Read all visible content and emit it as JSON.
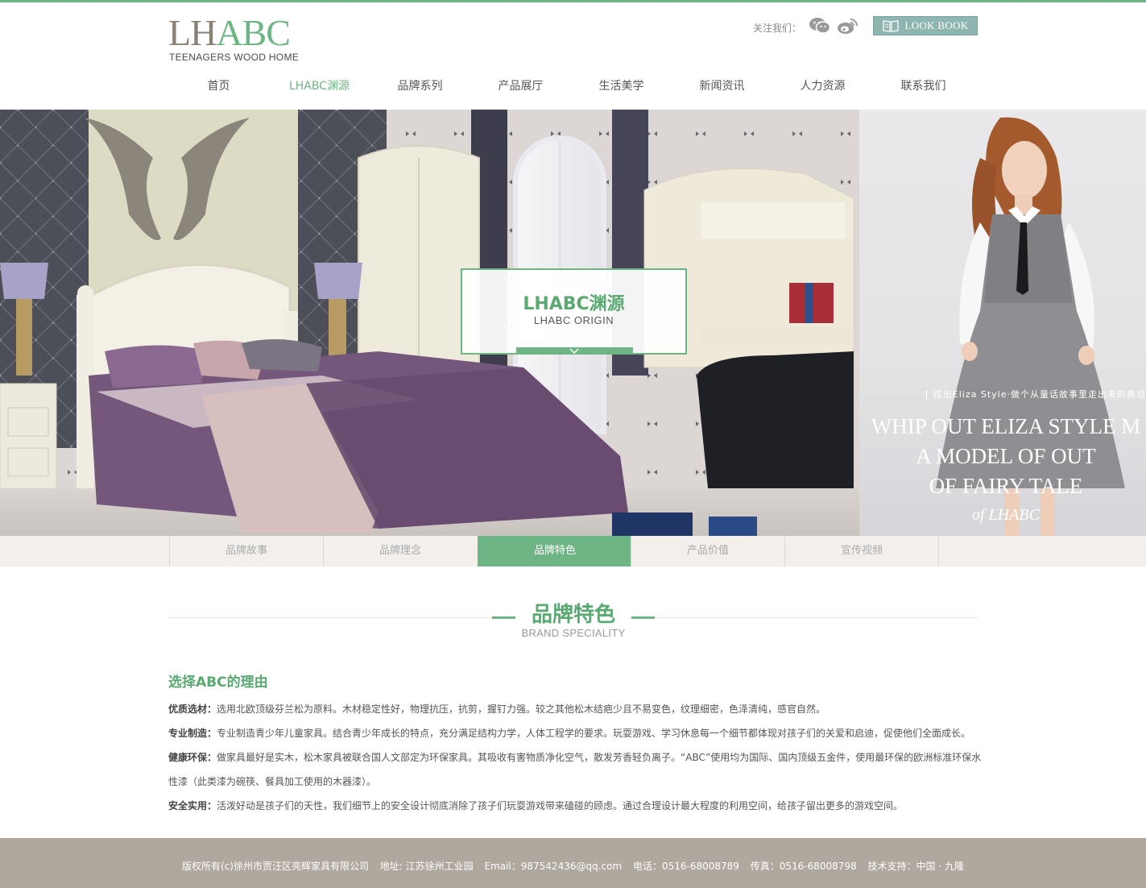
{
  "colors": {
    "accent": "#6db583",
    "accent_dark": "#5aa872",
    "footer_bg": "#b0a79f",
    "lookbook_bg": "#8fb5b0"
  },
  "header": {
    "logo_lh": "LH",
    "logo_abc": "ABC",
    "logo_tagline": "TEENAGERS WOOD HOME",
    "follow_label": "关注我们：",
    "social_icons": [
      "wechat-icon",
      "weibo-icon"
    ],
    "lookbook_label": "LOOK BOOK"
  },
  "nav": {
    "items": [
      {
        "label": "首页"
      },
      {
        "label": "LHABC渊源",
        "active": true
      },
      {
        "label": "品牌系列"
      },
      {
        "label": "产品展厅"
      },
      {
        "label": "生活美学"
      },
      {
        "label": "新闻资讯"
      },
      {
        "label": "人力资源"
      },
      {
        "label": "联系我们"
      }
    ]
  },
  "banner": {
    "box_title": "LHABC渊源",
    "box_subtitle": "LHABC ORIGIN",
    "fashion_small": "[ 炫出Eliza Style·做个从童话故事里走出来的典范",
    "fashion_line1": "WHIP OUT ELIZA STYLE M",
    "fashion_line2": "A MODEL OF OUT",
    "fashion_line3": "OF FAIRY TALE",
    "fashion_of": "of LHABC"
  },
  "subnav": {
    "tabs": [
      {
        "label": "品牌故事"
      },
      {
        "label": "品牌理念"
      },
      {
        "label": "品牌特色",
        "active": true
      },
      {
        "label": "产品价值"
      },
      {
        "label": "宣传视频"
      }
    ]
  },
  "section": {
    "title": "品牌特色",
    "subtitle": "BRAND SPECIALITY"
  },
  "content": {
    "heading": "选择ABC的理由",
    "items": [
      {
        "key": "优质选材：",
        "text": "选用北欧顶级芬兰松为原料。木材稳定性好，物理抗压，抗剪，握钉力强。较之其他松木结疤少且不易变色，纹理细密，色泽清纯，感官自然。"
      },
      {
        "key": "专业制造：",
        "text": "专业制造青少年儿童家具。结合青少年成长的特点，充分满足结构力学，人体工程学的要求。玩耍游戏、学习休息每一个细节都体现对孩子们的关爱和启迪，促使他们全面成长。"
      },
      {
        "key": "健康环保：",
        "text": "做家具最好是实木，松木家具被联合国人文部定为环保家具。其吸收有害物质净化空气，散发芳香轻负离子。“ABC”使用均为国际、国内顶级五金件，使用最环保的欧洲标准环保水性漆（此类漆为碗筷、餐具加工使用的木器漆）。"
      },
      {
        "key": "安全实用：",
        "text": "活泼好动是孩子们的天性，我们细节上的安全设计彻底消除了孩子们玩耍游戏带来磕碰的顾虑。通过合理设计最大程度的利用空间，给孩子留出更多的游戏空间。"
      }
    ]
  },
  "footer": {
    "copyright": "版权所有(c)徐州市贾汪区亮辉家具有限公司",
    "address": "地址: 江苏徐州工业园",
    "email": "Email：987542436@qq.com",
    "phone": "电话：0516-68008789",
    "fax": "传真：0516-68008798",
    "support": "技术支持：中国 · 九隆"
  }
}
